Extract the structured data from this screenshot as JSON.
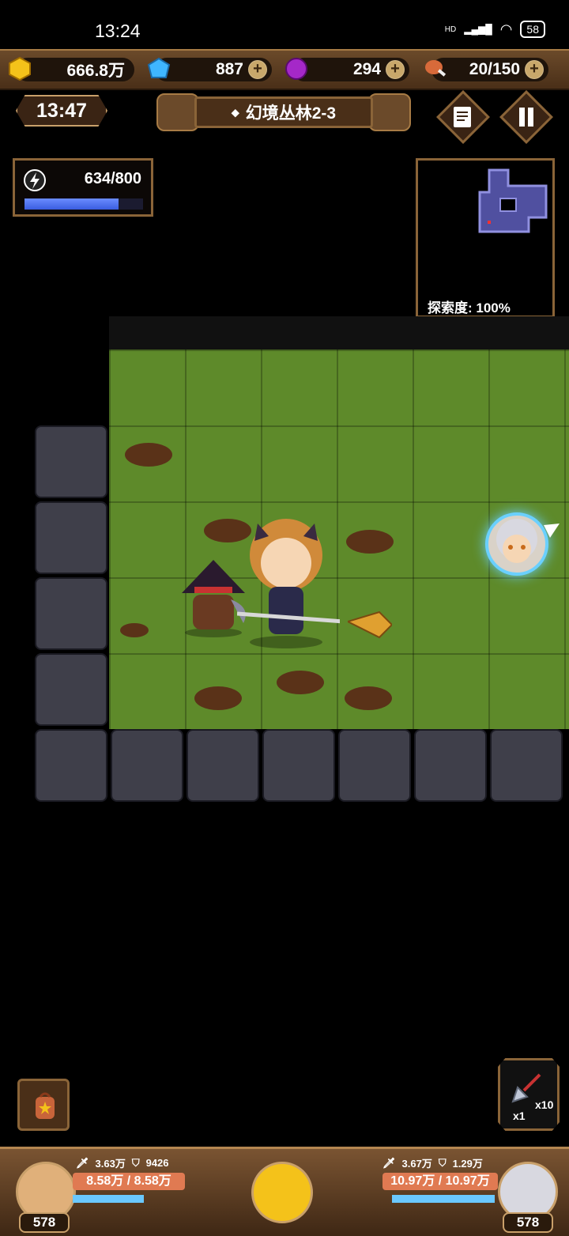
{
  "status_bar": {
    "time": "13:24",
    "network": "HD",
    "battery": "58"
  },
  "resources": {
    "gold": {
      "value": "666.8万"
    },
    "gems": {
      "value": "887"
    },
    "elixir": {
      "value": "294"
    },
    "food": {
      "value": "20/150"
    }
  },
  "timer": "13:47",
  "stage_title": "幻境丛林2-3",
  "energy": {
    "text": "634/800",
    "fraction": 0.7925
  },
  "minimap": {
    "exploration_label": "探索度: 100%"
  },
  "tool": {
    "count_left": "x1",
    "count_right": "x10"
  },
  "left_hero": {
    "attack": "3.63万",
    "defense": "9426",
    "hp": "8.58万 / 8.58万",
    "level": "578"
  },
  "right_hero": {
    "attack": "3.67万",
    "defense": "1.29万",
    "hp": "10.97万 / 10.97万",
    "level": "578"
  },
  "colors": {
    "accent_wood": "#8a6438",
    "grass": "#5e8a2a",
    "energy": "#4a6cf0",
    "hp": "#e07a52"
  }
}
